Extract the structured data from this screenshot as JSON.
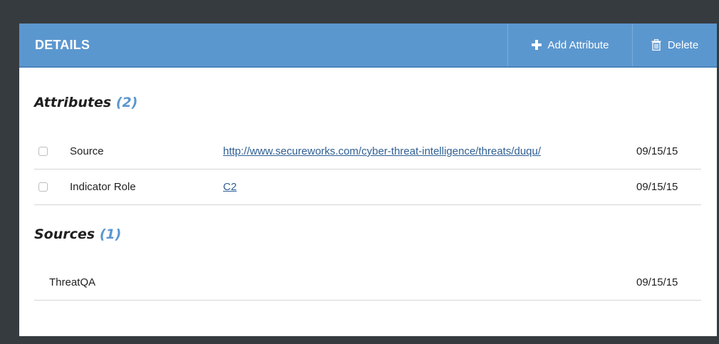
{
  "header": {
    "title": "DETAILS",
    "add_attribute_label": "Add Attribute",
    "delete_label": "Delete"
  },
  "attributes": {
    "title": "Attributes",
    "count": "(2)",
    "rows": [
      {
        "name": "Source",
        "value": "http://www.secureworks.com/cyber-threat-intelligence/threats/duqu/",
        "date": "09/15/15"
      },
      {
        "name": "Indicator Role",
        "value": "C2",
        "date": "09/15/15"
      }
    ]
  },
  "sources": {
    "title": "Sources",
    "count": "(1)",
    "rows": [
      {
        "name": "ThreatQA",
        "date": "09/15/15"
      }
    ]
  },
  "colors": {
    "header_bg": "#5b97cf",
    "accent": "#5b97cf",
    "link": "#2f5f93",
    "page_bg": "#363b40"
  },
  "icons": {
    "add": "plus-icon",
    "delete": "trash-icon"
  }
}
